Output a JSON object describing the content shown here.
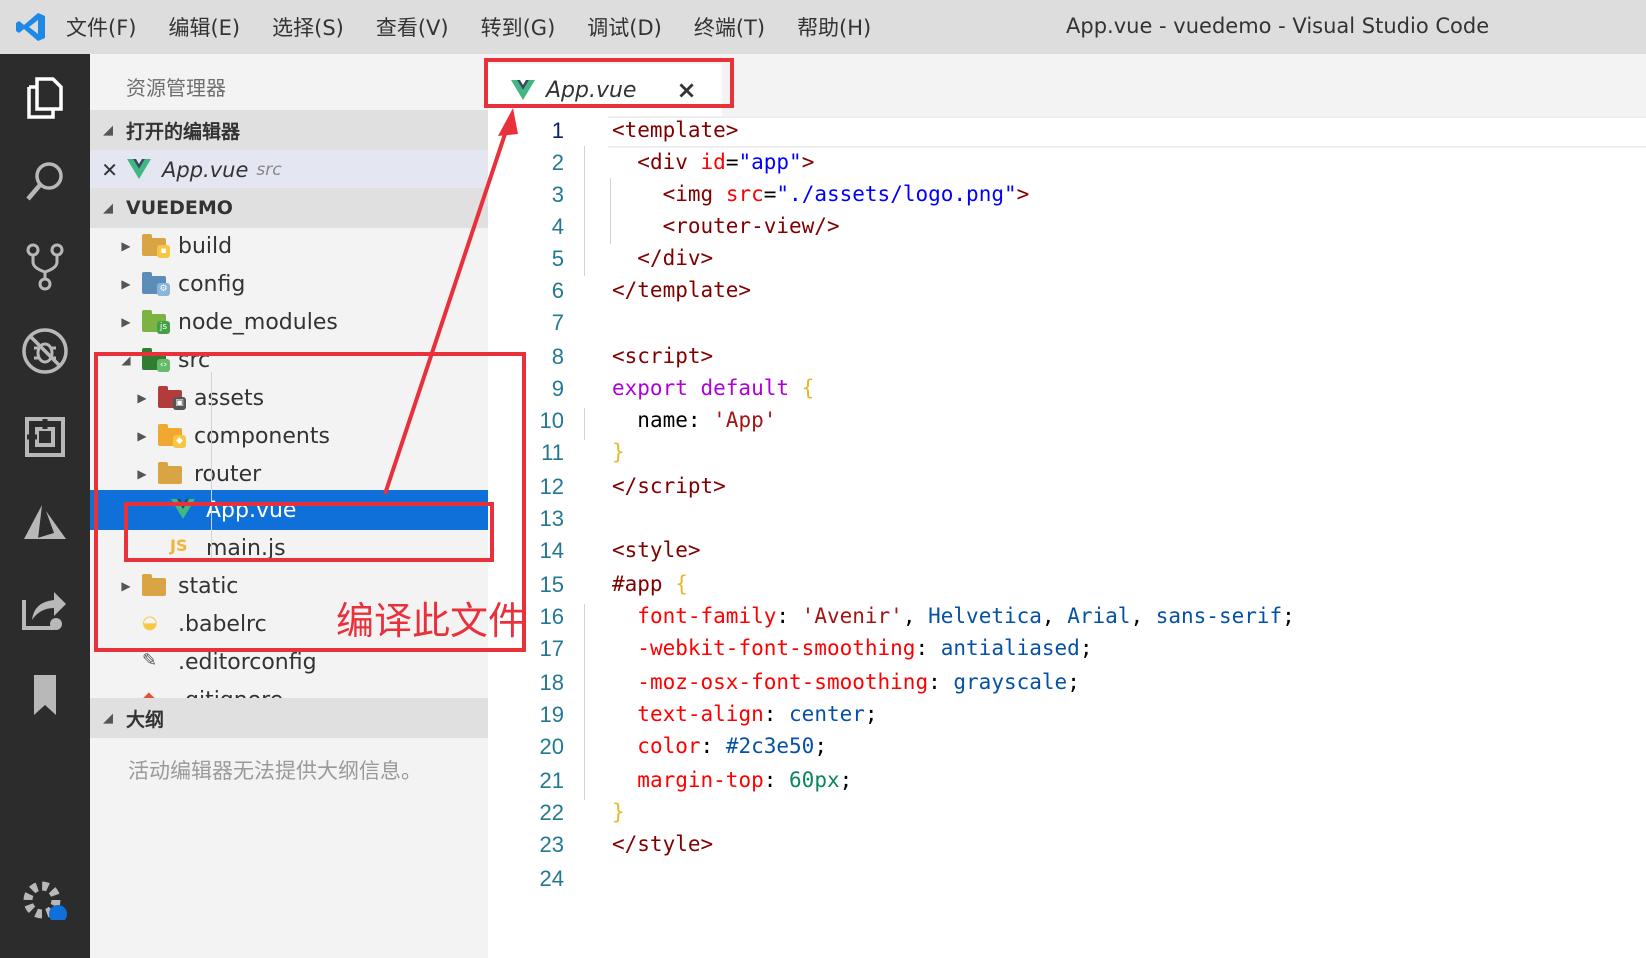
{
  "window": {
    "title": "App.vue - vuedemo - Visual Studio Code"
  },
  "menu": [
    "文件(F)",
    "编辑(E)",
    "选择(S)",
    "查看(V)",
    "转到(G)",
    "调试(D)",
    "终端(T)",
    "帮助(H)"
  ],
  "activity_bar": [
    "explorer-icon",
    "search-icon",
    "source-control-icon",
    "debug-icon",
    "extensions-icon",
    "azure-icon",
    "live-share-icon",
    "bookmark-icon",
    "settings-gear-icon"
  ],
  "sidebar": {
    "title": "资源管理器",
    "open_editors": {
      "header": "打开的编辑器",
      "items": [
        {
          "name": "App.vue",
          "path": "src"
        }
      ]
    },
    "project": {
      "header": "VUEDEMO",
      "items": [
        {
          "name": "build"
        },
        {
          "name": "config"
        },
        {
          "name": "node_modules"
        },
        {
          "name": "src"
        },
        {
          "name": "assets"
        },
        {
          "name": "components"
        },
        {
          "name": "router"
        },
        {
          "name": "App.vue"
        },
        {
          "name": "main.js"
        },
        {
          "name": "static"
        },
        {
          "name": ".babelrc"
        },
        {
          "name": ".editorconfig"
        },
        {
          "name": ".gitignore"
        }
      ]
    },
    "outline": {
      "header": "大纲",
      "message": "活动编辑器无法提供大纲信息。"
    }
  },
  "tabs": [
    {
      "label": "App.vue",
      "close": "×"
    }
  ],
  "editor": {
    "line_numbers": [
      "1",
      "2",
      "3",
      "4",
      "5",
      "6",
      "7",
      "8",
      "9",
      "10",
      "11",
      "12",
      "13",
      "14",
      "15",
      "16",
      "17",
      "18",
      "19",
      "20",
      "21",
      "22",
      "23",
      "24"
    ]
  },
  "annotation": {
    "text": "编译此文件",
    "color": "#e8313a"
  },
  "colors": {
    "accent": "#0e70d8",
    "activity_bar": "#2c2c2c",
    "annotation": "#e8313a"
  }
}
